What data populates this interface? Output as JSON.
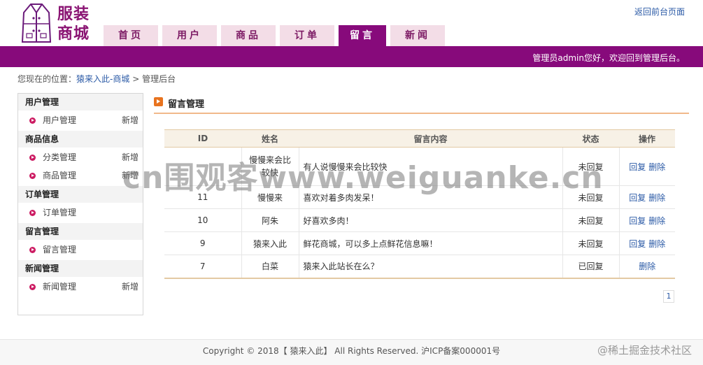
{
  "header": {
    "logo_text_line1": "服装",
    "logo_text_line2": "商城",
    "back_link": "返回前台页面",
    "welcome": "管理员admin您好，欢迎回到管理后台。",
    "nav": [
      "首页",
      "用户",
      "商品",
      "订单",
      "留言",
      "新闻"
    ],
    "active_tab": "留言",
    "brand_color": "#870a7b"
  },
  "breadcrumb": {
    "prefix": "您现在的位置：",
    "home": "猿来入此-商城",
    "sep": ">",
    "current": "管理后台"
  },
  "sidebar": {
    "groups": [
      {
        "title": "用户管理",
        "items": [
          {
            "label": "用户管理",
            "extra": "新增"
          }
        ]
      },
      {
        "title": "商品信息",
        "items": [
          {
            "label": "分类管理",
            "extra": "新增"
          },
          {
            "label": "商品管理",
            "extra": "新增"
          }
        ]
      },
      {
        "title": "订单管理",
        "items": [
          {
            "label": "订单管理",
            "extra": ""
          }
        ]
      },
      {
        "title": "留言管理",
        "items": [
          {
            "label": "留言管理",
            "extra": ""
          }
        ]
      },
      {
        "title": "新闻管理",
        "items": [
          {
            "label": "新闻管理",
            "extra": "新增"
          }
        ]
      }
    ]
  },
  "main": {
    "title": "留言管理",
    "columns": [
      "ID",
      "姓名",
      "留言内容",
      "状态",
      "操作"
    ],
    "rows": [
      {
        "id": "",
        "name": "慢慢来会比较快",
        "content": "有人说慢慢来会比较快",
        "status": "未回复",
        "actions": [
          "回复",
          "删除"
        ]
      },
      {
        "id": "11",
        "name": "慢慢来",
        "content": "喜欢对着多肉发呆！",
        "status": "未回复",
        "actions": [
          "回复",
          "删除"
        ]
      },
      {
        "id": "10",
        "name": "阿朱",
        "content": "好喜欢多肉！",
        "status": "未回复",
        "actions": [
          "回复",
          "删除"
        ]
      },
      {
        "id": "9",
        "name": "猿来入此",
        "content": "鲜花商城，可以多上点鲜花信息嘛！",
        "status": "未回复",
        "actions": [
          "回复",
          "删除"
        ]
      },
      {
        "id": "7",
        "name": "白菜",
        "content": "猿来入此站长在么？",
        "status": "已回复",
        "actions": [
          "删除"
        ]
      }
    ],
    "pager": "1"
  },
  "footer": {
    "copyright": "Copyright © 2018【 猿来入此】 All Rights Reserved. 沪ICP备案000001号",
    "watermark_corner": "@稀土掘金技术社区"
  },
  "watermark": "cn围观客www.weiguanke.cn"
}
